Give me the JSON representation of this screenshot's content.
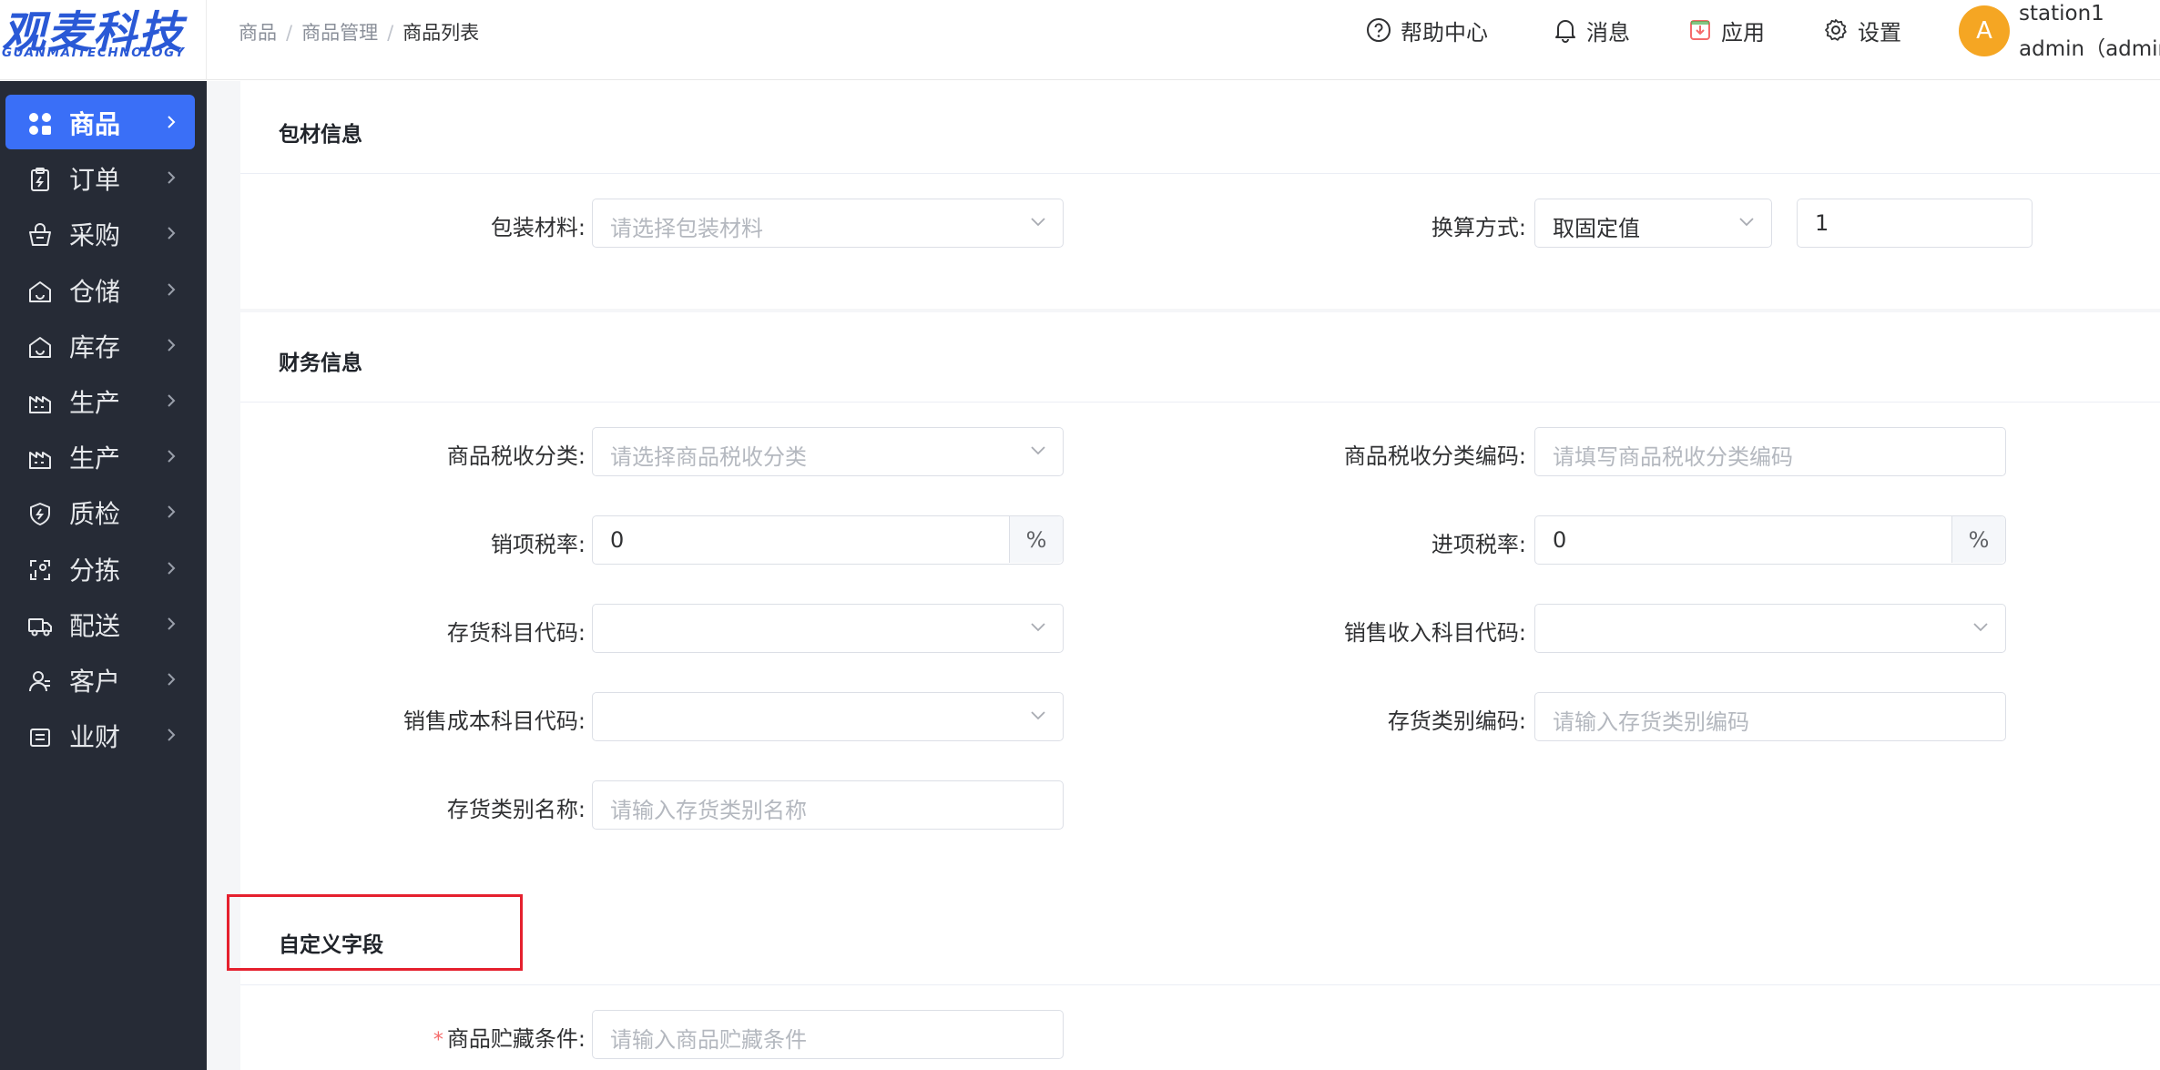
{
  "logo": {
    "cn": "观麦科技",
    "en": "GUANMAITECHNOLOGY"
  },
  "breadcrumb": {
    "items": [
      "商品",
      "商品管理"
    ],
    "current": "商品列表"
  },
  "header": {
    "help": "帮助中心",
    "messages": "消息",
    "apps": "应用",
    "settings": "设置",
    "avatar_letter": "A",
    "user_line1": "station1",
    "user_line2": "admin（admin"
  },
  "sidebar": {
    "items": [
      {
        "label": "商品",
        "icon": "grid-icon",
        "active": true
      },
      {
        "label": "订单",
        "icon": "clipboard-icon"
      },
      {
        "label": "采购",
        "icon": "basket-icon"
      },
      {
        "label": "仓储",
        "icon": "warehouse-icon"
      },
      {
        "label": "库存",
        "icon": "warehouse-icon"
      },
      {
        "label": "生产",
        "icon": "factory-icon"
      },
      {
        "label": "生产",
        "icon": "factory-icon"
      },
      {
        "label": "质检",
        "icon": "shield-icon"
      },
      {
        "label": "分拣",
        "icon": "sort-icon"
      },
      {
        "label": "配送",
        "icon": "truck-icon"
      },
      {
        "label": "客户",
        "icon": "user-icon"
      },
      {
        "label": "业财",
        "icon": "finance-icon"
      }
    ]
  },
  "packaging": {
    "title": "包材信息",
    "material_label": "包装材料:",
    "material_placeholder": "请选择包装材料",
    "conversion_label": "换算方式:",
    "conversion_value": "取固定值",
    "conversion_number": "1"
  },
  "finance": {
    "title": "财务信息",
    "tax_category_label": "商品税收分类:",
    "tax_category_placeholder": "请选择商品税收分类",
    "tax_code_label": "商品税收分类编码:",
    "tax_code_placeholder": "请填写商品税收分类编码",
    "sales_tax_label": "销项税率:",
    "sales_tax_value": "0",
    "sales_tax_suffix": "%",
    "input_tax_label": "进项税率:",
    "input_tax_value": "0",
    "input_tax_suffix": "%",
    "inventory_account_label": "存货科目代码:",
    "sales_income_account_label": "销售收入科目代码:",
    "sales_cost_account_label": "销售成本科目代码:",
    "inventory_category_code_label": "存货类别编码:",
    "inventory_category_code_placeholder": "请输入存货类别编码",
    "inventory_category_name_label": "存货类别名称:",
    "inventory_category_name_placeholder": "请输入存货类别名称"
  },
  "custom": {
    "title": "自定义字段",
    "storage_label": "商品贮藏条件:",
    "storage_placeholder": "请输入商品贮藏条件"
  },
  "colors": {
    "accent": "#3a6ff7",
    "sidebar_bg": "#262b36",
    "highlight": "#e5202e",
    "avatar": "#f5a623"
  }
}
